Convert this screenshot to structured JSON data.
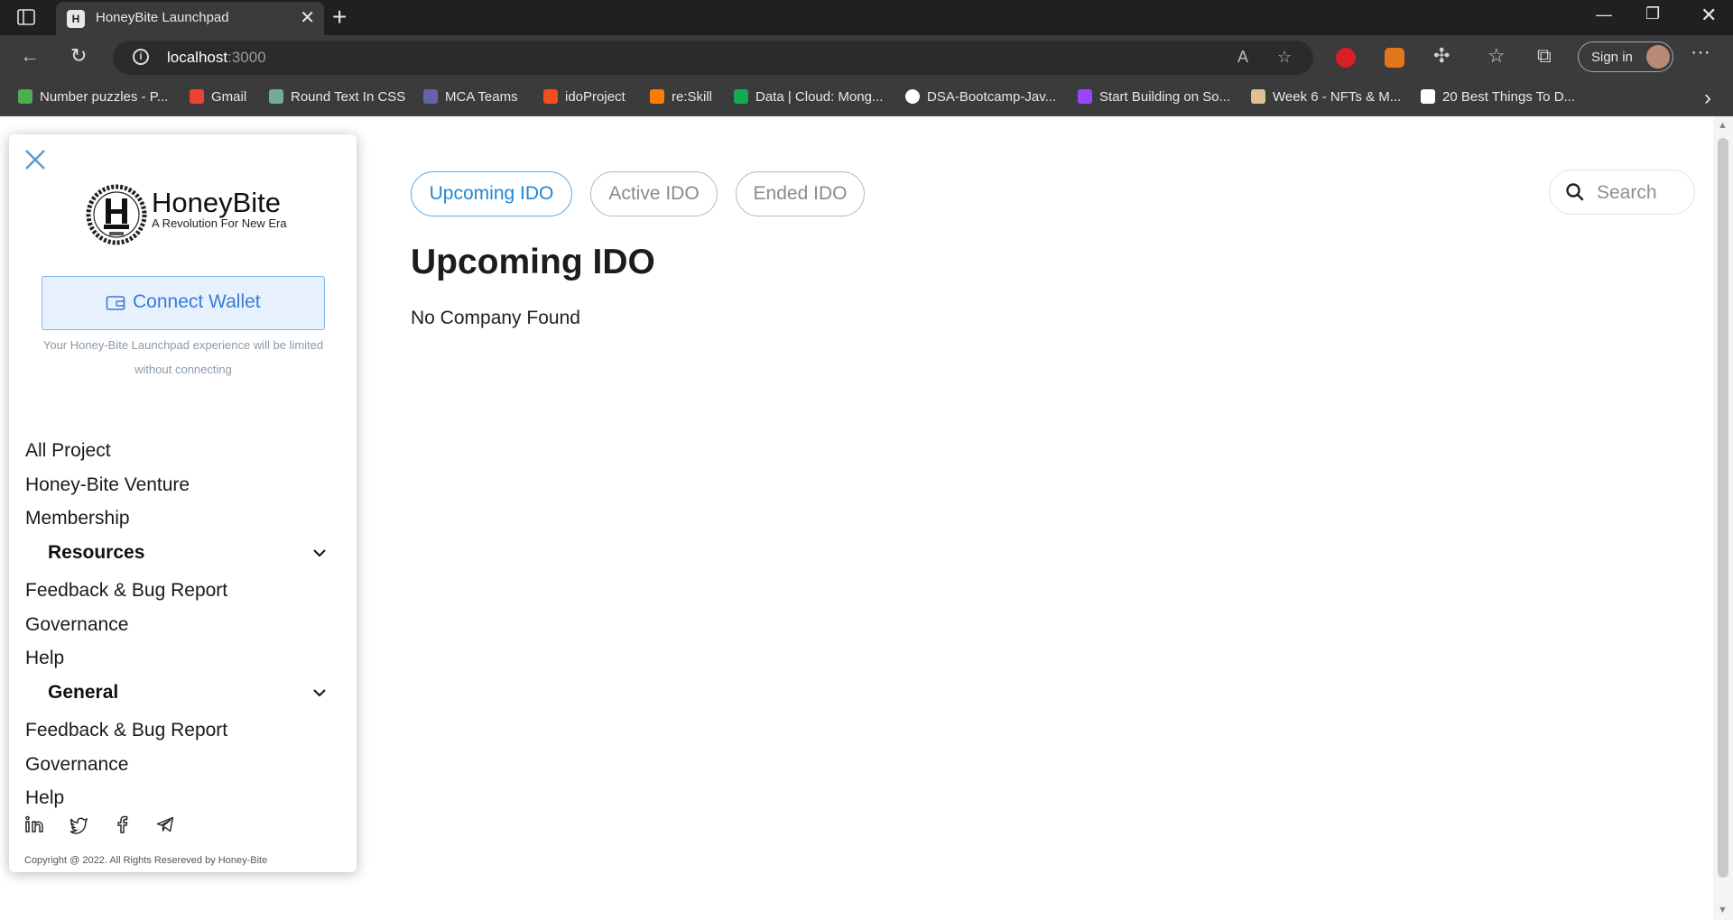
{
  "browser": {
    "tab_title": "HoneyBite Launchpad",
    "url_host": "localhost",
    "url_port": ":3000",
    "sign_in": "Sign in",
    "bookmarks": [
      {
        "label": "Number puzzles - P...",
        "color": "#4caf50"
      },
      {
        "label": "Gmail",
        "color": "#ea4335"
      },
      {
        "label": "Round Text In CSS",
        "color": "#74aa9c"
      },
      {
        "label": "MCA Teams",
        "color": "#6264a7"
      },
      {
        "label": "idoProject",
        "color": "#f24e1e"
      },
      {
        "label": "re:Skill",
        "color": "#ff7a00"
      },
      {
        "label": "Data | Cloud: Mong...",
        "color": "#13aa52"
      },
      {
        "label": "DSA-Bootcamp-Jav...",
        "color": "#ffffff"
      },
      {
        "label": "Start Building on So...",
        "color": "#9945ff"
      },
      {
        "label": "Week 6 - NFTs & M...",
        "color": "#e0c090"
      },
      {
        "label": "20 Best Things To D...",
        "color": "#ffffff"
      }
    ]
  },
  "main": {
    "tabs": [
      {
        "label": "Upcoming IDO",
        "active": true
      },
      {
        "label": "Active IDO",
        "active": false
      },
      {
        "label": "Ended IDO",
        "active": false
      }
    ],
    "search_placeholder": "Search",
    "heading": "Upcoming IDO",
    "empty_message": "No Company Found"
  },
  "sidebar": {
    "brand": "HoneyBite",
    "tagline": "A Revolution For New Era",
    "connect_wallet": "Connect Wallet",
    "connect_note": "Your Honey-Bite Launchpad experience will be limited without connecting",
    "nav_items": [
      "All Project",
      "Honey-Bite Venture",
      "Membership"
    ],
    "sections": [
      {
        "title": "Resources",
        "items": [
          "Feedback & Bug Report",
          "Governance",
          "Help"
        ]
      },
      {
        "title": "General",
        "items": [
          "Feedback & Bug Report",
          "Governance",
          "Help"
        ]
      }
    ],
    "social": [
      "linkedin-icon",
      "twitter-icon",
      "facebook-icon",
      "telegram-icon"
    ],
    "copyright": "Copyright @ 2022. All Rights Resereved by Honey-Bite"
  },
  "colors": {
    "accent": "#1f87d6",
    "wallet_bg": "#e7f1fd",
    "wallet_border": "#7fb1ea"
  }
}
